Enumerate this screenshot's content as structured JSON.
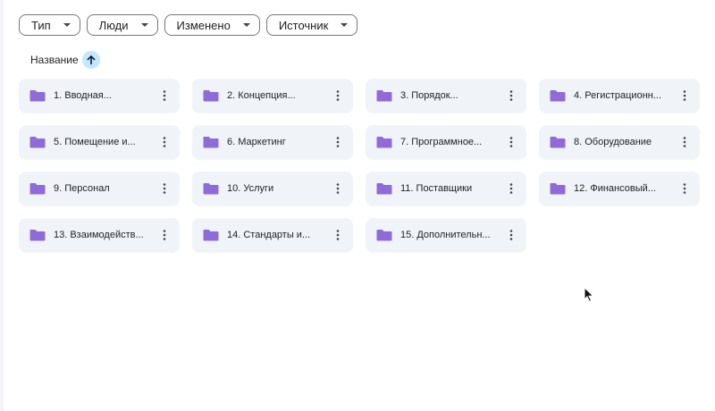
{
  "filters": [
    {
      "label": "Тип",
      "name": "filter-type"
    },
    {
      "label": "Люди",
      "name": "filter-people"
    },
    {
      "label": "Изменено",
      "name": "filter-modified"
    },
    {
      "label": "Источник",
      "name": "filter-source"
    }
  ],
  "sort": {
    "label": "Название",
    "direction_icon": "arrow-up-icon"
  },
  "colors": {
    "folder_icon": "#8e6bd9",
    "tile_bg": "#f0f4f9",
    "sort_button_bg": "#c2e7ff"
  },
  "folders": [
    {
      "name": "1. Вводная..."
    },
    {
      "name": "2. Концепция..."
    },
    {
      "name": "3. Порядок..."
    },
    {
      "name": "4. Регистрационн..."
    },
    {
      "name": "5. Помещение и..."
    },
    {
      "name": "6. Маркетинг"
    },
    {
      "name": "7. Программное..."
    },
    {
      "name": "8. Оборудование"
    },
    {
      "name": "9. Персонал"
    },
    {
      "name": "10. Услуги"
    },
    {
      "name": "11. Поставщики"
    },
    {
      "name": "12. Финансовый..."
    },
    {
      "name": "13. Взаимодейств..."
    },
    {
      "name": "14. Стандарты и..."
    },
    {
      "name": "15. Дополнительн..."
    }
  ]
}
